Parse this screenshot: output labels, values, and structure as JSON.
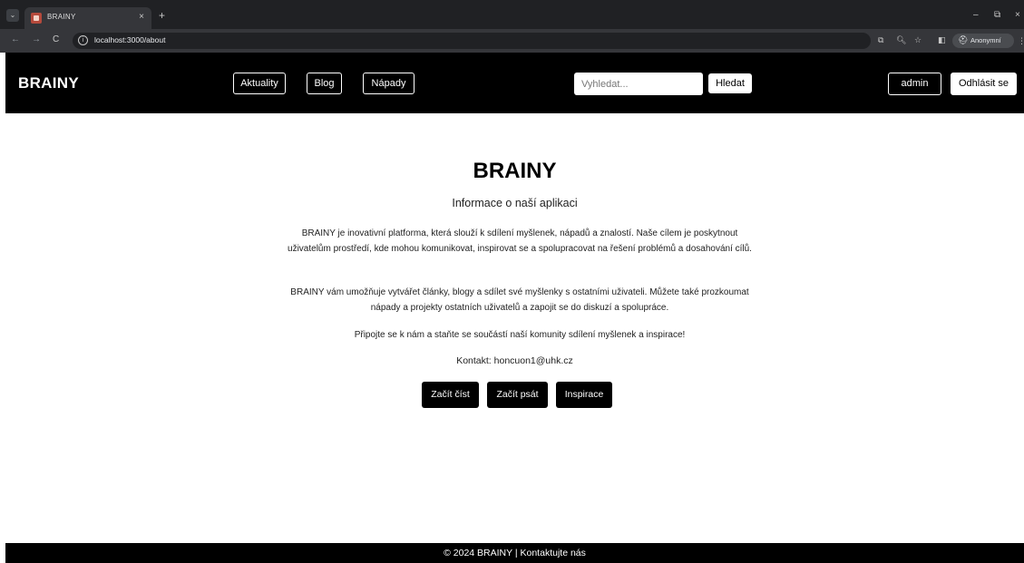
{
  "browser": {
    "tab_title": "BRAINY",
    "tab_close": "×",
    "new_tab": "+",
    "url": "localhost:3000/about",
    "incognito_label": "Anonymní",
    "minimize": "–",
    "maximize": "⧉",
    "close": "×",
    "nav_back": "←",
    "nav_forward": "→",
    "reload": "C",
    "info": "i",
    "translate": "⧉",
    "zoom": "🔍︎",
    "bookmark": "☆",
    "sidepanel": "◧",
    "incognito_icon": "⛑",
    "menu": "⋮",
    "tab_menu": "⌄"
  },
  "navbar": {
    "brand": "BRAINY",
    "links": [
      "Aktuality",
      "Blog",
      "Nápady"
    ],
    "search_placeholder": "Vyhledat...",
    "search_button": "Hledat",
    "user": "admin",
    "logout": "Odhlásit se"
  },
  "main": {
    "title": "BRAINY",
    "subtitle": "Informace o naší aplikaci",
    "paragraph1": "BRAINY je inovativní platforma, která slouží k sdílení myšlenek, nápadů a znalostí. Naše cílem je poskytnout uživatelům prostředí, kde mohou komunikovat, inspirovat se a spolupracovat na řešení problémů a dosahování cílů.",
    "paragraph2": "BRAINY vám umožňuje vytvářet články, blogy a sdílet své myšlenky s ostatními uživateli. Můžete také prozkoumat nápady a projekty ostatních uživatelů a zapojit se do diskuzí a spolupráce.",
    "paragraph3": "Připojte se k nám a staňte se součástí naší komunity sdílení myšlenek a inspirace!",
    "contact": "Kontakt: honcuon1@uhk.cz",
    "buttons": [
      "Začít číst",
      "Začít psát",
      "Inspirace"
    ]
  },
  "footer": {
    "text": "© 2024 BRAINY | Kontaktujte nás"
  }
}
